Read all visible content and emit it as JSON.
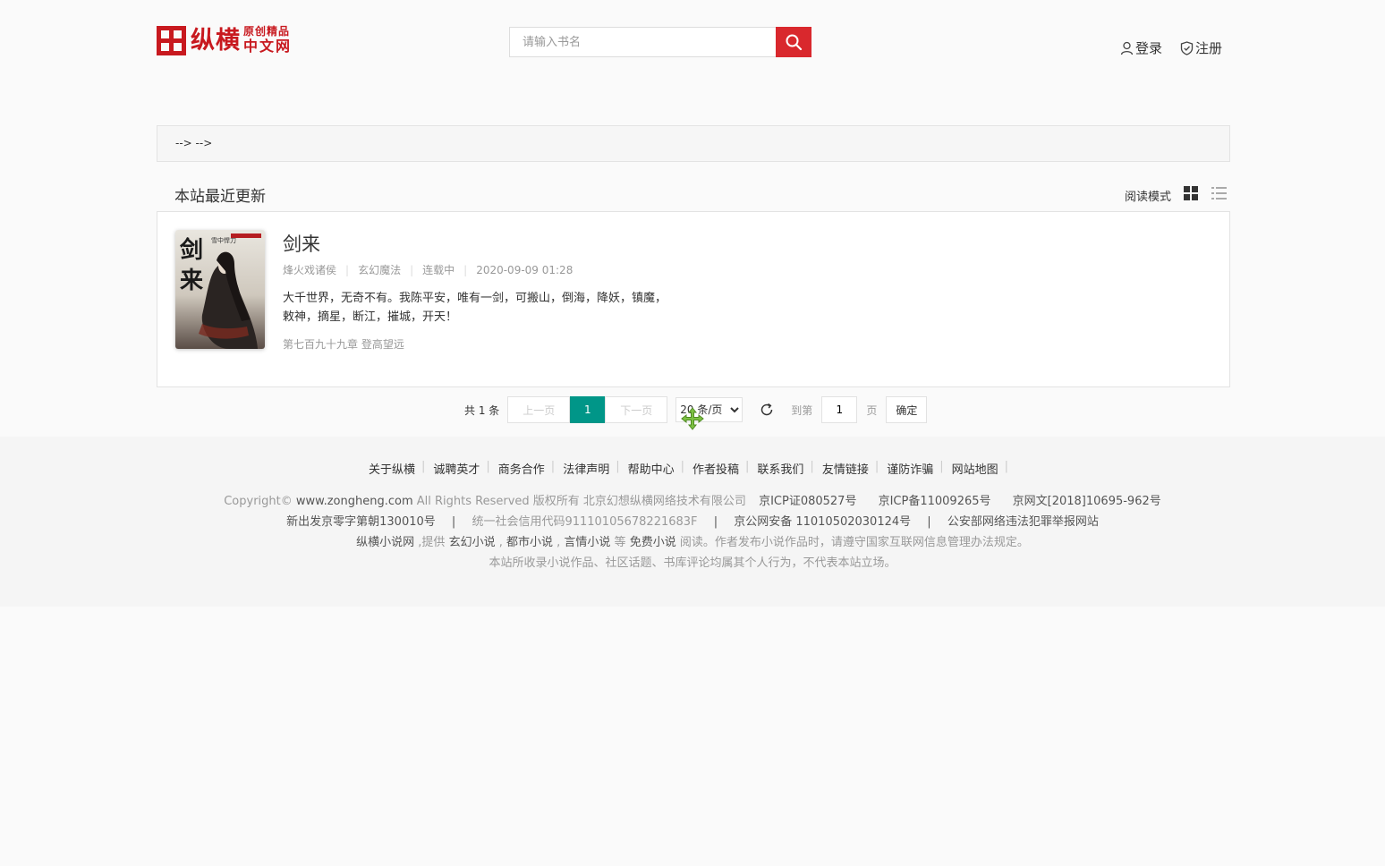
{
  "header": {
    "logo_main": "纵横",
    "logo_side_top": "原创精品",
    "logo_side_bottom": "中文网",
    "search_placeholder": "请输入书名",
    "login": "登录",
    "register": "注册"
  },
  "breadcrumb": "--> -->",
  "section": {
    "title": "本站最近更新",
    "mode_label": "阅读模式"
  },
  "book": {
    "title": "剑来",
    "author": "烽火戏诸侯",
    "category": "玄幻魔法",
    "status": "连载中",
    "updated": "2020-09-09 01:28",
    "description": "大千世界，无奇不有。我陈平安，唯有一剑，可搬山，倒海，降妖，镇魔，敕神，摘星，断江，摧城，开天！",
    "latest_chapter": "第七百九十九章 登高望远",
    "cover_text": "剑来"
  },
  "pager": {
    "total": "共 1 条",
    "prev": "上一页",
    "current": "1",
    "next": "下一页",
    "page_size": "20 条/页",
    "goto_label": "到第",
    "goto_value": "1",
    "page_unit": "页",
    "confirm": "确定"
  },
  "footer": {
    "nav": [
      "关于纵横",
      "诚聘英才",
      "商务合作",
      "法律声明",
      "帮助中心",
      "作者投稿",
      "联系我们",
      "友情链接",
      "谨防诈骗",
      "网站地图"
    ],
    "line1_prefix": "Copyright© ",
    "line1_domain": "www.zongheng.com",
    "line1_rights": " All Rights Reserved 版权所有 北京幻想纵横网络技术有限公司",
    "line1_icp1": "京ICP证080527号",
    "line1_icp2": "京ICP备11009265号",
    "line1_icp3": "京网文[2018]10695-962号",
    "line2_a": "新出发京零字第朝130010号",
    "line2_b": "统一社会信用代码91110105678221683F",
    "line2_c": "京公网安备 11010502030124号",
    "line2_d": "公安部网络违法犯罪举报网站",
    "line3_a": "纵横小说网",
    "line3_b": " ,提供 ",
    "line3_c": "玄幻小说",
    "line3_d": "都市小说",
    "line3_e": "言情小说",
    "line3_f": " 等 ",
    "line3_g": "免费小说",
    "line3_h": " 阅读。作者发布小说作品时，请遵守国家互联网信息管理办法规定。",
    "line4": "本站所收录小说作品、社区话题、书库评论均属其个人行为，不代表本站立场。"
  },
  "colors": {
    "brand_red": "#c8191f",
    "search_red": "#d9282d",
    "pager_active": "#009688"
  }
}
